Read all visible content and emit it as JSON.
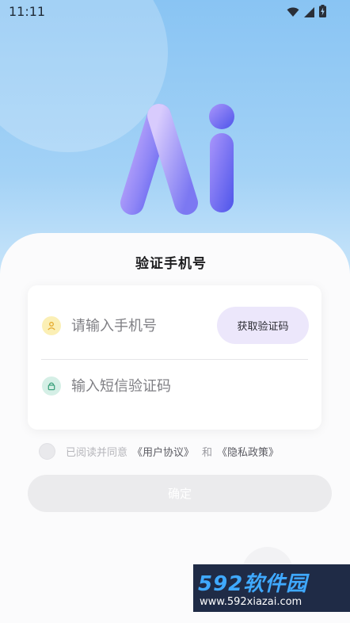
{
  "status_bar": {
    "time": "11:11",
    "icons": [
      "wifi-icon",
      "cellular-signal-icon",
      "battery-charging-icon"
    ]
  },
  "logo": {
    "text": "Ai",
    "colors": {
      "start": "#b49cfb",
      "end": "#5c64ef"
    }
  },
  "sheet": {
    "title": "验证手机号"
  },
  "form": {
    "phone": {
      "icon": "user-icon",
      "placeholder": "请输入手机号",
      "value": ""
    },
    "get_code_label": "获取验证码",
    "code": {
      "icon": "lock-icon",
      "placeholder": "输入短信验证码",
      "value": ""
    }
  },
  "agreement": {
    "checked": false,
    "prefix": "已阅读并同意",
    "user_agreement": "《用户协议》",
    "and_text": "和",
    "privacy_policy": "《隐私政策》"
  },
  "confirm_label": "确定",
  "watermark": {
    "line1": "592软件园",
    "line2": "www.592xiazai.com"
  },
  "colors": {
    "accent_purple": "#ece7fb",
    "background_blue": "#89c4f3"
  }
}
